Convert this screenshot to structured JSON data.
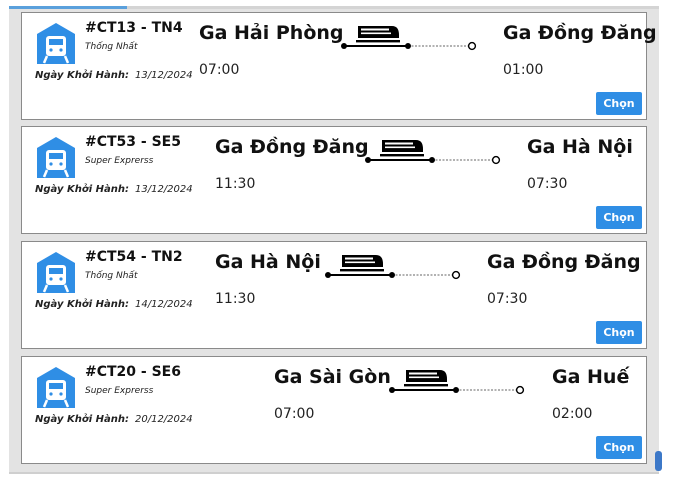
{
  "depart_label": "Ngày Khởi Hành:",
  "select_label": "Chọn",
  "icons": {
    "station": "train-station-icon",
    "train": "train-icon"
  },
  "colors": {
    "accent": "#2f8ee5",
    "icon_blue": "#2f8ee5",
    "card_border": "#8a8a8a"
  },
  "trips": [
    {
      "code": "#CT13 - TN4",
      "train_name": "Thống Nhất",
      "depart_date": "13/12/2024",
      "from_station": "Ga Hải Phòng",
      "from_time": "07:00",
      "to_station": "Ga Đồng Đăng",
      "to_time": "01:00"
    },
    {
      "code": "#CT53 - SE5",
      "train_name": "Super Exprerss",
      "depart_date": "13/12/2024",
      "from_station": "Ga Đồng Đăng",
      "from_time": "11:30",
      "to_station": "Ga Hà Nội",
      "to_time": "07:30"
    },
    {
      "code": "#CT54 - TN2",
      "train_name": "Thống Nhất",
      "depart_date": "14/12/2024",
      "from_station": "Ga Hà Nội",
      "from_time": "11:30",
      "to_station": "Ga Đồng Đăng",
      "to_time": "07:30"
    },
    {
      "code": "#CT20 - SE6",
      "train_name": "Super Exprerss",
      "depart_date": "20/12/2024",
      "from_station": "Ga Sài Gòn",
      "from_time": "07:00",
      "to_station": "Ga Huế",
      "to_time": "02:00"
    }
  ]
}
